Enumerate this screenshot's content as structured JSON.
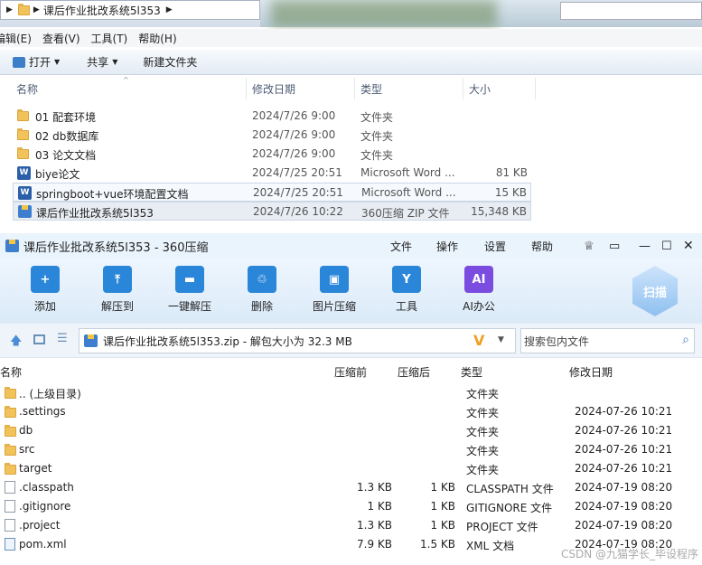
{
  "explorer": {
    "address_crumb": "课后作业批改系统5l353",
    "menu": [
      "编辑(E)",
      "查看(V)",
      "工具(T)",
      "帮助(H)"
    ],
    "cmds": {
      "open": "打开",
      "share": "共享",
      "new_folder": "新建文件夹"
    },
    "columns": {
      "name": "名称",
      "date": "修改日期",
      "type": "类型",
      "size": "大小"
    },
    "files": [
      {
        "name": "01 配套环境",
        "date": "2024/7/26 9:00",
        "type": "文件夹",
        "size": "",
        "icon": "folder"
      },
      {
        "name": "02 db数据库",
        "date": "2024/7/26 9:00",
        "type": "文件夹",
        "size": "",
        "icon": "folder"
      },
      {
        "name": "03 论文文档",
        "date": "2024/7/26 9:00",
        "type": "文件夹",
        "size": "",
        "icon": "folder"
      },
      {
        "name": "biye论文",
        "date": "2024/7/25 20:51",
        "type": "Microsoft Word ...",
        "size": "81 KB",
        "icon": "word"
      },
      {
        "name": "springboot+vue环境配置文档",
        "date": "2024/7/25 20:51",
        "type": "Microsoft Word ...",
        "size": "15 KB",
        "icon": "word"
      },
      {
        "name": "课后作业批改系统5l353",
        "date": "2024/7/26 10:22",
        "type": "360压缩 ZIP 文件",
        "size": "15,348 KB",
        "icon": "zip"
      }
    ]
  },
  "zip": {
    "title": "课后作业批改系统5l353 - 360压缩",
    "title_menu": [
      "文件",
      "操作",
      "设置",
      "帮助"
    ],
    "tools": [
      {
        "label": "添加",
        "icon": "add-icon",
        "color": "#2a86d8"
      },
      {
        "label": "解压到",
        "icon": "extract-to-icon",
        "color": "#2a86d8"
      },
      {
        "label": "一键解压",
        "icon": "one-click-extract-icon",
        "color": "#2a86d8"
      },
      {
        "label": "删除",
        "icon": "trash-icon",
        "color": "#2a86d8"
      },
      {
        "label": "图片压缩",
        "icon": "image-compress-icon",
        "color": "#2a86d8"
      },
      {
        "label": "工具",
        "icon": "tools-icon",
        "color": "#2a86d8"
      },
      {
        "label": "AI办公",
        "icon": "ai-office-icon",
        "color": "#7a4de0"
      }
    ],
    "scan_label": "扫描",
    "path_text": "课后作业批改系统5l353.zip - 解包大小为 32.3 MB",
    "search_placeholder": "搜索包内文件",
    "columns": {
      "name": "名称",
      "before": "压缩前",
      "after": "压缩后",
      "type": "类型",
      "date": "修改日期"
    },
    "rows": [
      {
        "name": ".. (上级目录)",
        "before": "",
        "after": "",
        "type": "文件夹",
        "date": "",
        "icon": "folder"
      },
      {
        "name": ".settings",
        "before": "",
        "after": "",
        "type": "文件夹",
        "date": "2024-07-26 10:21",
        "icon": "folder"
      },
      {
        "name": "db",
        "before": "",
        "after": "",
        "type": "文件夹",
        "date": "2024-07-26 10:21",
        "icon": "folder"
      },
      {
        "name": "src",
        "before": "",
        "after": "",
        "type": "文件夹",
        "date": "2024-07-26 10:21",
        "icon": "folder"
      },
      {
        "name": "target",
        "before": "",
        "after": "",
        "type": "文件夹",
        "date": "2024-07-26 10:21",
        "icon": "folder"
      },
      {
        "name": ".classpath",
        "before": "1.3 KB",
        "after": "1 KB",
        "type": "CLASSPATH 文件",
        "date": "2024-07-19 08:20",
        "icon": "doc"
      },
      {
        "name": ".gitignore",
        "before": "1 KB",
        "after": "1 KB",
        "type": "GITIGNORE 文件",
        "date": "2024-07-19 08:20",
        "icon": "doc"
      },
      {
        "name": ".project",
        "before": "1.3 KB",
        "after": "1 KB",
        "type": "PROJECT 文件",
        "date": "2024-07-19 08:20",
        "icon": "doc"
      },
      {
        "name": "pom.xml",
        "before": "7.9 KB",
        "after": "1.5 KB",
        "type": "XML 文档",
        "date": "2024-07-19 08:20",
        "icon": "xml"
      }
    ]
  },
  "watermark": "CSDN @九猫学长_毕设程序"
}
